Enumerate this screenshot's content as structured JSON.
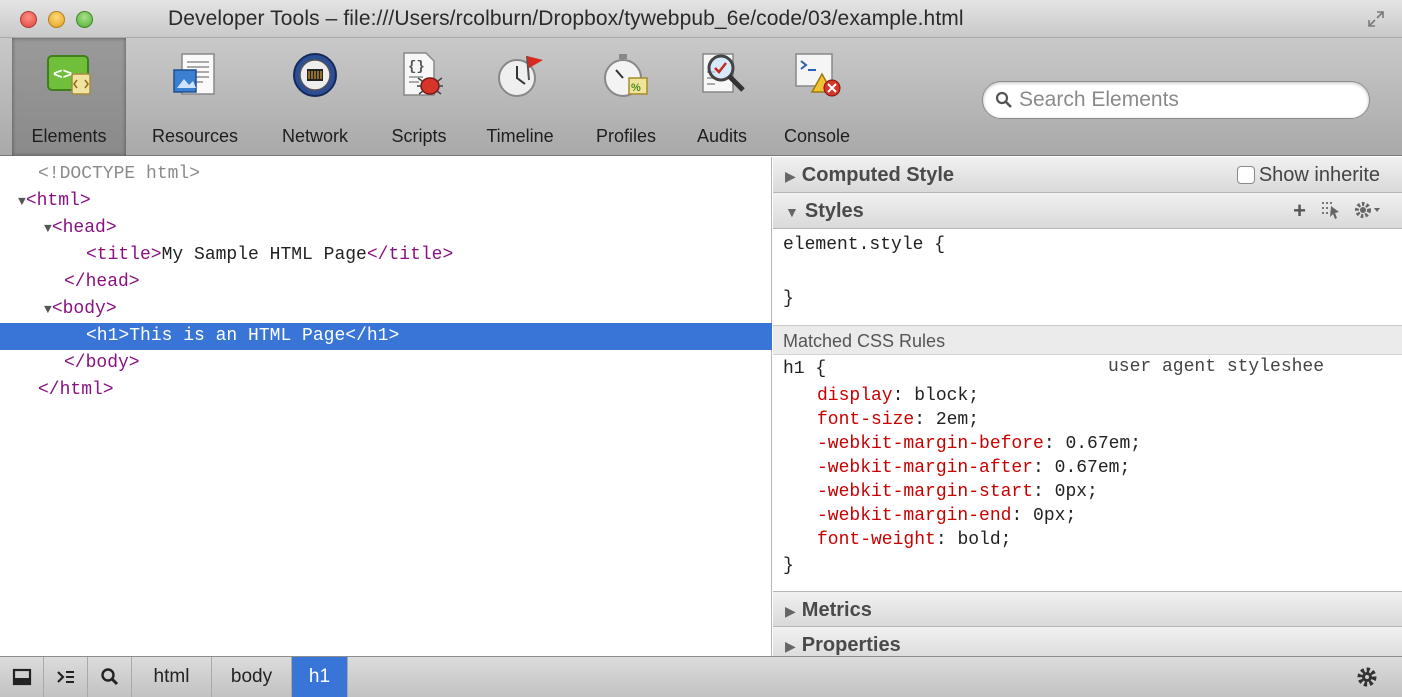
{
  "window": {
    "title": "Developer Tools – file:///Users/rcolburn/Dropbox/tywebpub_6e/code/03/example.html"
  },
  "toolbar": {
    "tabs": [
      {
        "label": "Elements",
        "icon": "elements-icon",
        "active": true
      },
      {
        "label": "Resources",
        "icon": "resources-icon"
      },
      {
        "label": "Network",
        "icon": "network-icon"
      },
      {
        "label": "Scripts",
        "icon": "scripts-icon"
      },
      {
        "label": "Timeline",
        "icon": "timeline-icon"
      },
      {
        "label": "Profiles",
        "icon": "profiles-icon"
      },
      {
        "label": "Audits",
        "icon": "audits-icon"
      },
      {
        "label": "Console",
        "icon": "console-icon"
      }
    ],
    "search_placeholder": "Search Elements"
  },
  "dom": {
    "doctype": "<!DOCTYPE html>",
    "html_open": "<html>",
    "head_open": "<head>",
    "title_open": "<title>",
    "title_text": "My Sample HTML Page",
    "title_close": "</title>",
    "head_close": "</head>",
    "body_open": "<body>",
    "h1_open": "<h1>",
    "h1_text": "This is an HTML Page",
    "h1_close": "</h1>",
    "body_close": "</body>",
    "html_close": "</html>"
  },
  "sidebar": {
    "computed_style": "Computed Style",
    "show_inherited": "Show inherite",
    "styles": "Styles",
    "element_style_open": "element.style {",
    "element_style_close": "}",
    "matched_css_rules": "Matched CSS Rules",
    "rule_selector": "h1 {",
    "rule_source": "user agent styleshee",
    "rule_close": "}",
    "declarations": [
      {
        "prop": "display",
        "value": "block;"
      },
      {
        "prop": "font-size",
        "value": "2em;"
      },
      {
        "prop": "-webkit-margin-before",
        "value": "0.67em;"
      },
      {
        "prop": "-webkit-margin-after",
        "value": "0.67em;"
      },
      {
        "prop": "-webkit-margin-start",
        "value": "0px;"
      },
      {
        "prop": "-webkit-margin-end",
        "value": "0px;"
      },
      {
        "prop": "font-weight",
        "value": "bold;"
      }
    ],
    "metrics": "Metrics",
    "properties": "Properties"
  },
  "statusbar": {
    "breadcrumbs": [
      "html",
      "body",
      "h1"
    ],
    "selected_crumb": "h1"
  },
  "colors": {
    "selection": "#3875d7",
    "tag": "#881280",
    "css_property": "#c80000"
  }
}
